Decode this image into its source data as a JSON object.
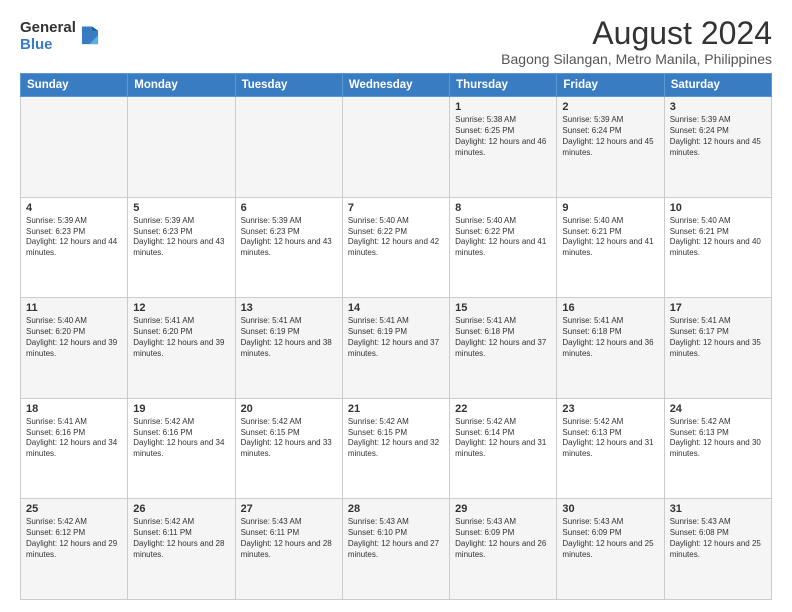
{
  "header": {
    "logo_line1": "General",
    "logo_line2": "Blue",
    "title": "August 2024",
    "subtitle": "Bagong Silangan, Metro Manila, Philippines"
  },
  "days_of_week": [
    "Sunday",
    "Monday",
    "Tuesday",
    "Wednesday",
    "Thursday",
    "Friday",
    "Saturday"
  ],
  "weeks": [
    [
      {
        "day": "",
        "info": ""
      },
      {
        "day": "",
        "info": ""
      },
      {
        "day": "",
        "info": ""
      },
      {
        "day": "",
        "info": ""
      },
      {
        "day": "1",
        "info": "Sunrise: 5:38 AM\nSunset: 6:25 PM\nDaylight: 12 hours and 46 minutes."
      },
      {
        "day": "2",
        "info": "Sunrise: 5:39 AM\nSunset: 6:24 PM\nDaylight: 12 hours and 45 minutes."
      },
      {
        "day": "3",
        "info": "Sunrise: 5:39 AM\nSunset: 6:24 PM\nDaylight: 12 hours and 45 minutes."
      }
    ],
    [
      {
        "day": "4",
        "info": "Sunrise: 5:39 AM\nSunset: 6:23 PM\nDaylight: 12 hours and 44 minutes."
      },
      {
        "day": "5",
        "info": "Sunrise: 5:39 AM\nSunset: 6:23 PM\nDaylight: 12 hours and 43 minutes."
      },
      {
        "day": "6",
        "info": "Sunrise: 5:39 AM\nSunset: 6:23 PM\nDaylight: 12 hours and 43 minutes."
      },
      {
        "day": "7",
        "info": "Sunrise: 5:40 AM\nSunset: 6:22 PM\nDaylight: 12 hours and 42 minutes."
      },
      {
        "day": "8",
        "info": "Sunrise: 5:40 AM\nSunset: 6:22 PM\nDaylight: 12 hours and 41 minutes."
      },
      {
        "day": "9",
        "info": "Sunrise: 5:40 AM\nSunset: 6:21 PM\nDaylight: 12 hours and 41 minutes."
      },
      {
        "day": "10",
        "info": "Sunrise: 5:40 AM\nSunset: 6:21 PM\nDaylight: 12 hours and 40 minutes."
      }
    ],
    [
      {
        "day": "11",
        "info": "Sunrise: 5:40 AM\nSunset: 6:20 PM\nDaylight: 12 hours and 39 minutes."
      },
      {
        "day": "12",
        "info": "Sunrise: 5:41 AM\nSunset: 6:20 PM\nDaylight: 12 hours and 39 minutes."
      },
      {
        "day": "13",
        "info": "Sunrise: 5:41 AM\nSunset: 6:19 PM\nDaylight: 12 hours and 38 minutes."
      },
      {
        "day": "14",
        "info": "Sunrise: 5:41 AM\nSunset: 6:19 PM\nDaylight: 12 hours and 37 minutes."
      },
      {
        "day": "15",
        "info": "Sunrise: 5:41 AM\nSunset: 6:18 PM\nDaylight: 12 hours and 37 minutes."
      },
      {
        "day": "16",
        "info": "Sunrise: 5:41 AM\nSunset: 6:18 PM\nDaylight: 12 hours and 36 minutes."
      },
      {
        "day": "17",
        "info": "Sunrise: 5:41 AM\nSunset: 6:17 PM\nDaylight: 12 hours and 35 minutes."
      }
    ],
    [
      {
        "day": "18",
        "info": "Sunrise: 5:41 AM\nSunset: 6:16 PM\nDaylight: 12 hours and 34 minutes."
      },
      {
        "day": "19",
        "info": "Sunrise: 5:42 AM\nSunset: 6:16 PM\nDaylight: 12 hours and 34 minutes."
      },
      {
        "day": "20",
        "info": "Sunrise: 5:42 AM\nSunset: 6:15 PM\nDaylight: 12 hours and 33 minutes."
      },
      {
        "day": "21",
        "info": "Sunrise: 5:42 AM\nSunset: 6:15 PM\nDaylight: 12 hours and 32 minutes."
      },
      {
        "day": "22",
        "info": "Sunrise: 5:42 AM\nSunset: 6:14 PM\nDaylight: 12 hours and 31 minutes."
      },
      {
        "day": "23",
        "info": "Sunrise: 5:42 AM\nSunset: 6:13 PM\nDaylight: 12 hours and 31 minutes."
      },
      {
        "day": "24",
        "info": "Sunrise: 5:42 AM\nSunset: 6:13 PM\nDaylight: 12 hours and 30 minutes."
      }
    ],
    [
      {
        "day": "25",
        "info": "Sunrise: 5:42 AM\nSunset: 6:12 PM\nDaylight: 12 hours and 29 minutes."
      },
      {
        "day": "26",
        "info": "Sunrise: 5:42 AM\nSunset: 6:11 PM\nDaylight: 12 hours and 28 minutes."
      },
      {
        "day": "27",
        "info": "Sunrise: 5:43 AM\nSunset: 6:11 PM\nDaylight: 12 hours and 28 minutes."
      },
      {
        "day": "28",
        "info": "Sunrise: 5:43 AM\nSunset: 6:10 PM\nDaylight: 12 hours and 27 minutes."
      },
      {
        "day": "29",
        "info": "Sunrise: 5:43 AM\nSunset: 6:09 PM\nDaylight: 12 hours and 26 minutes."
      },
      {
        "day": "30",
        "info": "Sunrise: 5:43 AM\nSunset: 6:09 PM\nDaylight: 12 hours and 25 minutes."
      },
      {
        "day": "31",
        "info": "Sunrise: 5:43 AM\nSunset: 6:08 PM\nDaylight: 12 hours and 25 minutes."
      }
    ]
  ]
}
